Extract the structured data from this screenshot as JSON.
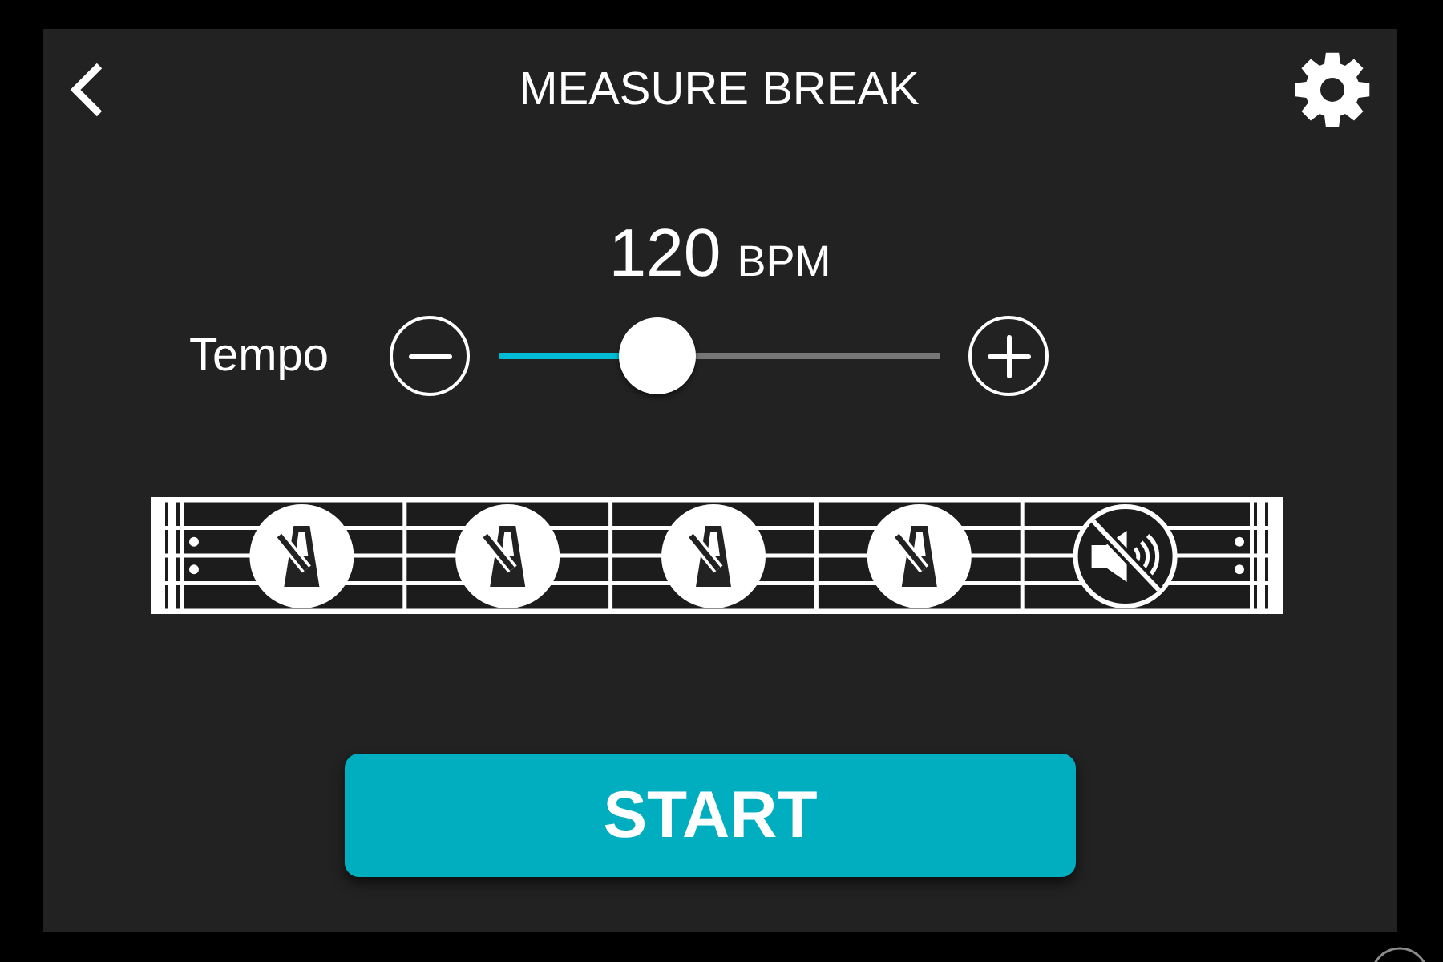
{
  "header": {
    "title": "MEASURE BREAK"
  },
  "tempo": {
    "value": "120",
    "unit": "BPM",
    "label": "Tempo",
    "level": 0.36
  },
  "measures": [
    {
      "muted": false
    },
    {
      "muted": false
    },
    {
      "muted": false
    },
    {
      "muted": false
    },
    {
      "muted": true
    }
  ],
  "start_button": {
    "label": "START"
  }
}
